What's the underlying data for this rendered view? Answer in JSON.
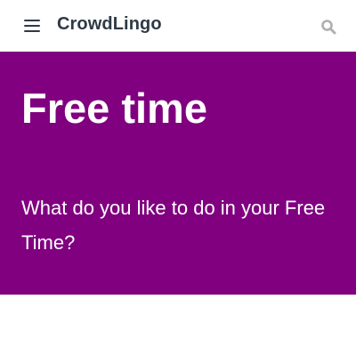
{
  "header": {
    "menu_icon": "hamburger-menu-icon",
    "brand": "CrowdLingo",
    "search_icon": "search-icon"
  },
  "hero": {
    "title": "Free time",
    "subtitle": "What do you like to do in your Free Time?"
  },
  "colors": {
    "hero_background": "#800080",
    "brand_text": "#2f3a45",
    "search_icon": "#b0b0b0"
  }
}
